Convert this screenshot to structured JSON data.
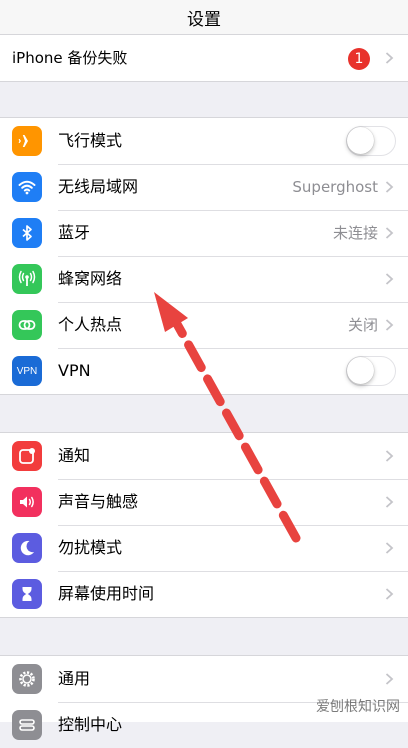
{
  "navbar": {
    "title": "设置"
  },
  "backup": {
    "label": "iPhone 备份失败",
    "badge": "1"
  },
  "network": {
    "airplane": {
      "label": "飞行模式",
      "icon": "airplane-icon",
      "color": "#ff9500"
    },
    "wifi": {
      "label": "无线局域网",
      "value": "Superghost",
      "icon": "wifi-icon",
      "color": "#1f7ef5"
    },
    "bluetooth": {
      "label": "蓝牙",
      "value": "未连接",
      "icon": "bluetooth-icon",
      "color": "#1f7ef5"
    },
    "cellular": {
      "label": "蜂窝网络",
      "icon": "cellular-antenna-icon",
      "color": "#34c759"
    },
    "hotspot": {
      "label": "个人热点",
      "value": "关闭",
      "icon": "hotspot-icon",
      "color": "#34c759"
    },
    "vpn": {
      "label": "VPN",
      "icon_text": "VPN",
      "icon": "vpn-icon",
      "color": "#1a6bd6"
    }
  },
  "general_group": {
    "notifications": {
      "label": "通知",
      "icon": "notifications-icon",
      "color": "#f23c3c"
    },
    "sounds": {
      "label": "声音与触感",
      "icon": "speaker-icon",
      "color": "#f2305e"
    },
    "dnd": {
      "label": "勿扰模式",
      "icon": "moon-icon",
      "color": "#5c5ce0"
    },
    "screentime": {
      "label": "屏幕使用时间",
      "icon": "hourglass-icon",
      "color": "#5c5ce0"
    }
  },
  "system_group": {
    "general": {
      "label": "通用",
      "icon": "gear-icon",
      "color": "#8e8e93"
    },
    "control_center": {
      "label": "控制中心",
      "icon": "control-center-icon",
      "color": "#8e8e93"
    }
  },
  "watermark": "爱刨根知识网",
  "annotation": {
    "arrow_color": "#e8433f"
  }
}
